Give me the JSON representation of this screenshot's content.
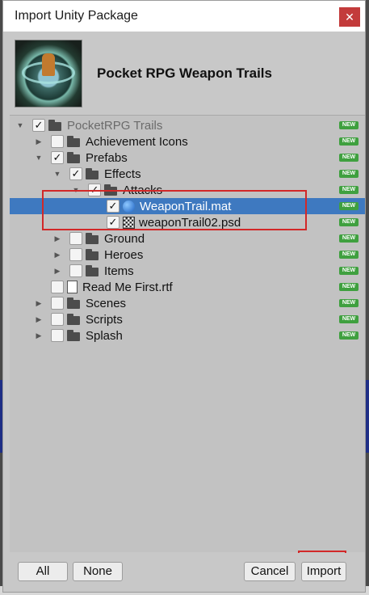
{
  "window": {
    "title": "Import Unity Package",
    "close_label": "✕"
  },
  "package": {
    "name": "Pocket RPG Weapon Trails"
  },
  "badge_label": "NEW",
  "tree": [
    {
      "label": "PocketRPG Trails",
      "arrow": "▼",
      "checked": true,
      "icon": "folder-icon",
      "dim": true
    },
    {
      "label": "Achievement Icons",
      "arrow": "▶",
      "checked": false,
      "icon": "folder-icon"
    },
    {
      "label": "Prefabs",
      "arrow": "▼",
      "checked": true,
      "icon": "folder-icon"
    },
    {
      "label": "Effects",
      "arrow": "▼",
      "checked": true,
      "icon": "folder-icon"
    },
    {
      "label": "Attacks",
      "arrow": "▼",
      "checked": true,
      "icon": "folder-icon"
    },
    {
      "label": "WeaponTrail.mat",
      "arrow": "",
      "checked": true,
      "icon": "material-icon",
      "selected": true
    },
    {
      "label": "weaponTrail02.psd",
      "arrow": "",
      "checked": true,
      "icon": "texture-icon"
    },
    {
      "label": "Ground",
      "arrow": "▶",
      "checked": false,
      "icon": "folder-icon"
    },
    {
      "label": "Heroes",
      "arrow": "▶",
      "checked": false,
      "icon": "folder-icon"
    },
    {
      "label": "Items",
      "arrow": "▶",
      "checked": false,
      "icon": "folder-icon"
    },
    {
      "label": "Read Me First.rtf",
      "arrow": "",
      "checked": false,
      "icon": "file-icon"
    },
    {
      "label": "Scenes",
      "arrow": "▶",
      "checked": false,
      "icon": "folder-icon"
    },
    {
      "label": "Scripts",
      "arrow": "▶",
      "checked": false,
      "icon": "folder-icon"
    },
    {
      "label": "Splash",
      "arrow": "▶",
      "checked": false,
      "icon": "folder-icon"
    }
  ],
  "buttons": {
    "all": "All",
    "none": "None",
    "cancel": "Cancel",
    "import": "Import"
  },
  "colors": {
    "selection": "#3e79c0",
    "badge": "#3fa03f",
    "highlight": "#d22828"
  }
}
